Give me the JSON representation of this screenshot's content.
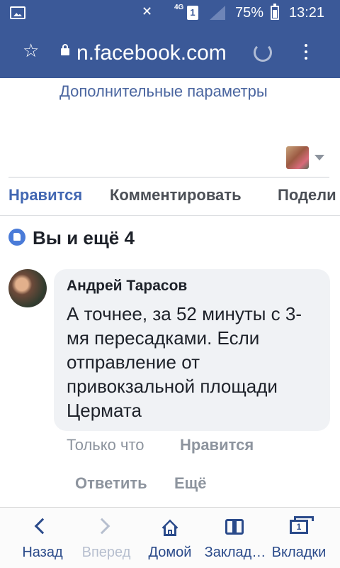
{
  "status_bar": {
    "network": "4G",
    "sim": "1",
    "battery": "75%",
    "time": "13:21"
  },
  "browser": {
    "url": "n.facebook.com"
  },
  "post": {
    "more_params": "Дополнительные параметры"
  },
  "actions": {
    "like": "Нравится",
    "comment": "Комментировать",
    "share": "Подели"
  },
  "reactions": {
    "text": "Вы и ещё 4"
  },
  "comment": {
    "author": "Андрей Тарасов",
    "text": "А точнее, за 52 минуты с 3-мя пересадками. Если отправление от привокзальной площади Цермата",
    "time": "Только что",
    "like": "Нравится",
    "reply": "Ответить",
    "more": "Ещё"
  },
  "bottom_nav": {
    "back": "Назад",
    "forward": "Вперед",
    "home": "Домой",
    "bookmarks": "Заклад…",
    "tabs": "Вкладки",
    "tabs_count": "1"
  },
  "colors": {
    "brand": "#3b5998",
    "link": "#4267b2",
    "bubble": "#f0f2f5",
    "nav": "#2a4a8a"
  }
}
